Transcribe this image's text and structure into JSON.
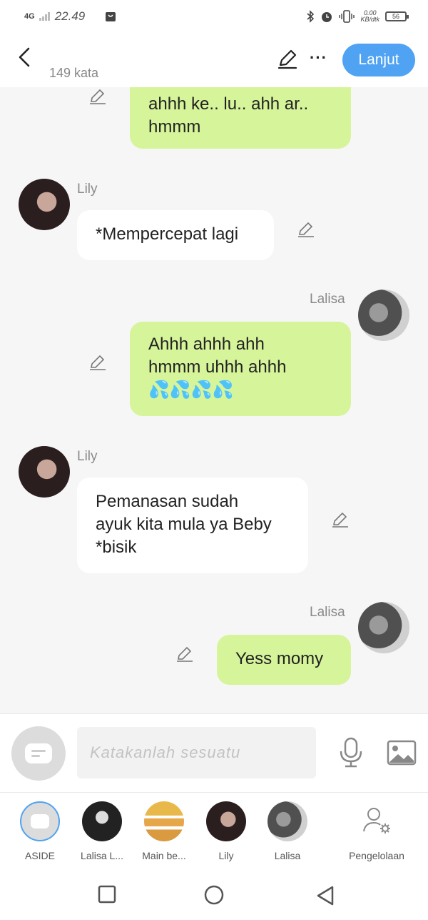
{
  "status": {
    "network": "4G",
    "time": "22.49",
    "speed_value": "0.00",
    "speed_unit": "KB/dtk",
    "battery": "56"
  },
  "header": {
    "word_count": "149 kata",
    "next_label": "Lanjut"
  },
  "messages": [
    {
      "side": "right",
      "speaker": "",
      "text_lines": [
        "ahhh ke.. lu.. ahh ar..",
        "hmmm"
      ]
    },
    {
      "side": "left",
      "speaker": "Lily",
      "text_lines": [
        "*Mempercepat lagi"
      ]
    },
    {
      "side": "right",
      "speaker": "Lalisa",
      "text_lines": [
        "Ahhh ahhh ahh",
        "hmmm uhhh ahhh",
        "💦💦💦💦"
      ]
    },
    {
      "side": "left",
      "speaker": "Lily",
      "text_lines": [
        "Pemanasan sudah",
        "ayuk kita mula ya Beby",
        "*bisik"
      ]
    },
    {
      "side": "right",
      "speaker": "Lalisa",
      "text_lines": [
        "Yess momy"
      ]
    }
  ],
  "input": {
    "placeholder": "Katakanlah sesuatu"
  },
  "tabs": [
    {
      "label": "ASIDE"
    },
    {
      "label": "Lalisa L..."
    },
    {
      "label": "Main be..."
    },
    {
      "label": "Lily"
    },
    {
      "label": "Lalisa"
    },
    {
      "label": "Pengelolaan"
    }
  ],
  "colors": {
    "accent": "#4fa3f2",
    "sent_bubble": "#d6f49a",
    "received_bubble": "#ffffff",
    "background": "#f6f6f6"
  },
  "icons": [
    "back-icon",
    "edit-icon",
    "more-icon",
    "pencil-icon",
    "mic-icon",
    "image-icon",
    "settings-person-icon",
    "square-icon",
    "circle-icon",
    "triangle-back-icon"
  ]
}
